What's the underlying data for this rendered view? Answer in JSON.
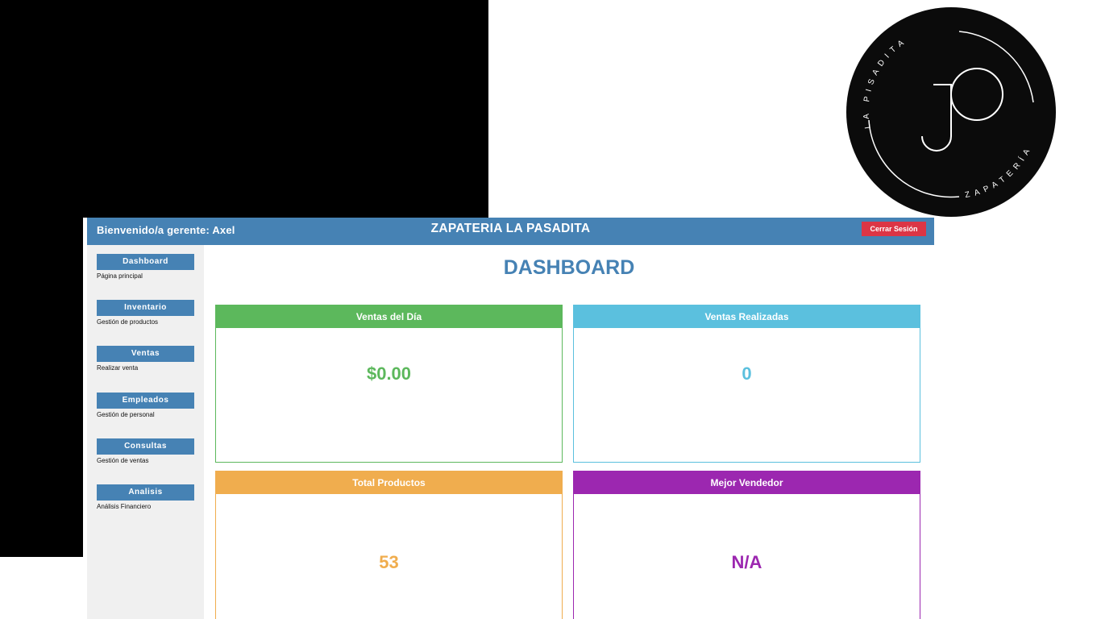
{
  "header": {
    "welcome": "Bienvenido/a gerente: Axel",
    "app_title": "ZAPATERIA LA PASADITA",
    "logout_label": "Cerrar Sesión"
  },
  "sidebar": {
    "items": [
      {
        "label": "Dashboard",
        "desc": "Página principal"
      },
      {
        "label": "Inventario",
        "desc": "Gestión de productos"
      },
      {
        "label": "Ventas",
        "desc": "Realizar venta"
      },
      {
        "label": "Empleados",
        "desc": "Gestión de personal"
      },
      {
        "label": "Consultas",
        "desc": "Gestión de ventas"
      },
      {
        "label": "Analisis",
        "desc": "Análisis Financiero"
      }
    ]
  },
  "main": {
    "title": "DASHBOARD",
    "cards": [
      {
        "title": "Ventas del Día",
        "value": "$0.00",
        "color": "#5cb85c"
      },
      {
        "title": "Ventas Realizadas",
        "value": "0",
        "color": "#5bc0de"
      },
      {
        "title": "Total Productos",
        "value": "53",
        "color": "#f0ad4e"
      },
      {
        "title": "Mejor Vendedor",
        "value": "N/A",
        "color": "#9c27b0"
      }
    ]
  },
  "logo": {
    "top_text": "LA PISADITA",
    "bottom_text": "ZAPATERÍA",
    "monogram_icon": "jp-monogram-icon"
  },
  "colors": {
    "primary": "#4682b4",
    "danger": "#dc3545",
    "sidebar_bg": "#f0f0f0"
  }
}
